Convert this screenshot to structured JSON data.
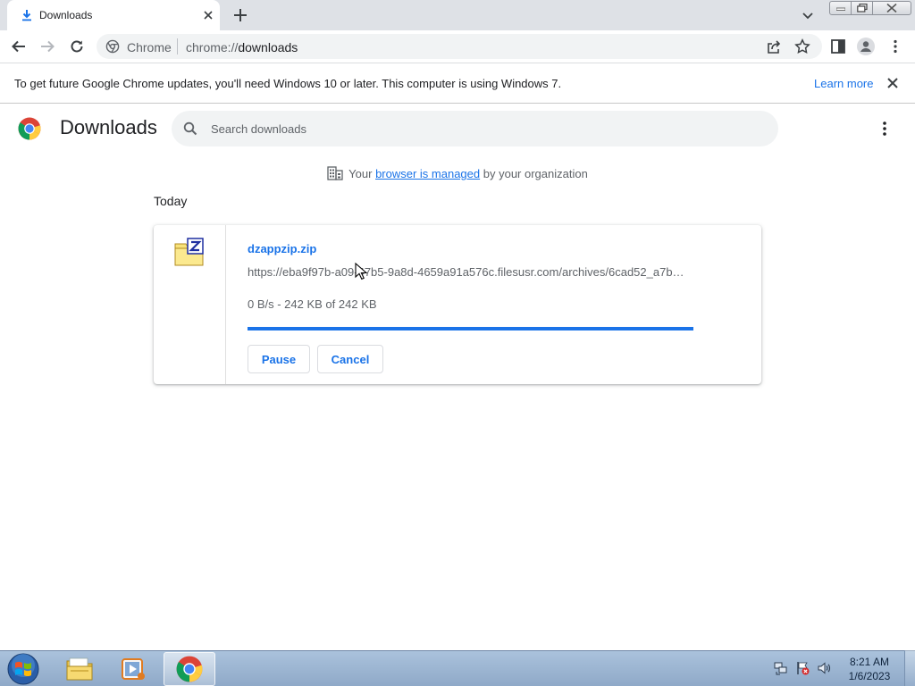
{
  "tab": {
    "title": "Downloads",
    "icon": "download-icon"
  },
  "toolbar": {
    "omnibox_site_label": "Chrome",
    "omnibox_url_scheme": "chrome://",
    "omnibox_url_path": "downloads"
  },
  "infobar": {
    "message": "To get future Google Chrome updates, you'll need Windows 10 or later. This computer is using Windows 7.",
    "link_label": "Learn more"
  },
  "downloads_page": {
    "title": "Downloads",
    "search_placeholder": "Search downloads",
    "managed_prefix": "Your",
    "managed_link": "browser is managed",
    "managed_suffix": "by your organization",
    "section_label": "Today"
  },
  "download_item": {
    "file_name": "dzappzip.zip",
    "url": "https://eba9f97b-a09-47b5-9a8d-4659a91a576c.filesusr.com/archives/6cad52_a7b…",
    "status": "0 B/s - 242 KB of 242 KB",
    "progress": 1.0,
    "pause_label": "Pause",
    "cancel_label": "Cancel"
  },
  "taskbar": {
    "apps": [
      "windows-explorer",
      "media-player",
      "google-chrome"
    ],
    "active_app": "google-chrome",
    "clock_time": "8:21 AM",
    "clock_date": "1/6/2023"
  },
  "colors": {
    "accent": "#1a73e8",
    "tabstrip": "#dee1e6",
    "omnibox": "#f1f3f4"
  }
}
